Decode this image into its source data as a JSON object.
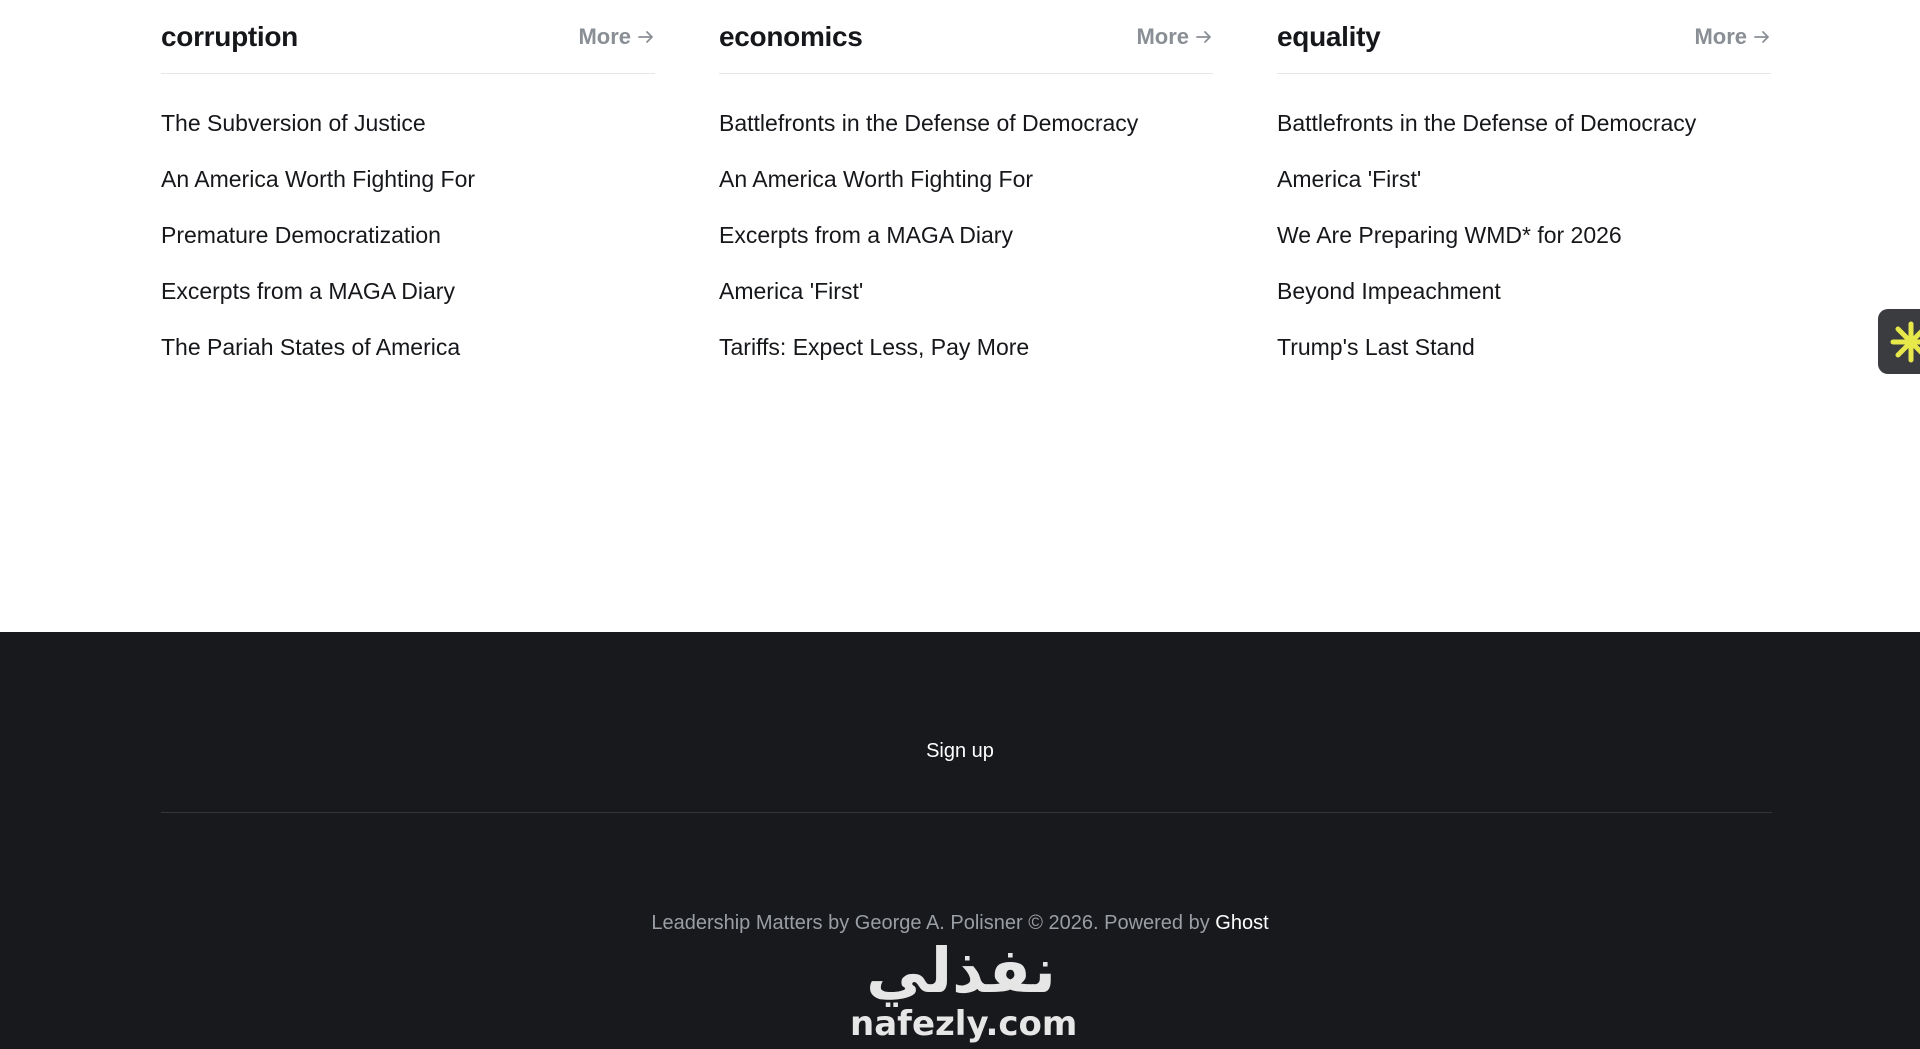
{
  "sections": [
    {
      "tag": "corruption",
      "more_label": "More",
      "posts": [
        "The Subversion of Justice",
        "An America Worth Fighting For",
        "Premature Democratization",
        "Excerpts from a MAGA Diary",
        "The Pariah States of America"
      ]
    },
    {
      "tag": "economics",
      "more_label": "More",
      "posts": [
        "Battlefronts in the Defense of Democracy",
        "An America Worth Fighting For",
        "Excerpts from a MAGA Diary",
        "America 'First'",
        "Tariffs: Expect Less, Pay More"
      ]
    },
    {
      "tag": "equality",
      "more_label": "More",
      "posts": [
        "Battlefronts in the Defense of Democracy",
        "America 'First'",
        "We Are Preparing WMD* for 2026",
        "Beyond Impeachment",
        "Trump's Last Stand"
      ]
    }
  ],
  "side_widget": {
    "icon": "asterisk-icon",
    "color": "#e7e84a"
  },
  "footer": {
    "signup_label": "Sign up",
    "copyright_text": "Leadership Matters by George A. Polisner © 2026. Powered by ",
    "ghost_link": "Ghost"
  },
  "watermark": {
    "arabic": "نفذلي",
    "latin": "nafezly.com"
  },
  "colors": {
    "text": "#15171a",
    "muted": "#8a8f96",
    "footer_bg": "#18191c"
  }
}
